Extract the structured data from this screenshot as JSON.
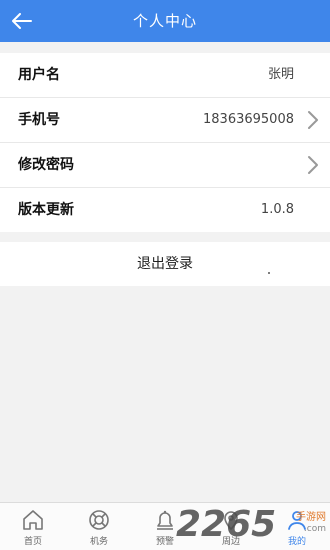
{
  "header": {
    "title": "个人中心"
  },
  "list": [
    {
      "label": "用户名",
      "value": "张明",
      "chevron": false
    },
    {
      "label": "手机号",
      "value": "18363695008",
      "chevron": true
    },
    {
      "label": "修改密码",
      "value": "",
      "chevron": true
    },
    {
      "label": "版本更新",
      "value": "1.0.8",
      "chevron": false
    }
  ],
  "logout_label": "退出登录",
  "tabs": [
    {
      "label": "首页",
      "icon": "home-icon",
      "active": false
    },
    {
      "label": "机务",
      "icon": "lifebuoy-icon",
      "active": false
    },
    {
      "label": "预警",
      "icon": "bell-icon",
      "active": false
    },
    {
      "label": "周边",
      "icon": "map-pin-icon",
      "active": false
    },
    {
      "label": "我的",
      "icon": "user-icon",
      "active": true
    }
  ],
  "watermark": {
    "number": "2265",
    "side_top": "手游网",
    "side_bottom": ".com"
  },
  "colors": {
    "primary": "#3f86ea",
    "background": "#f2f2f2"
  }
}
